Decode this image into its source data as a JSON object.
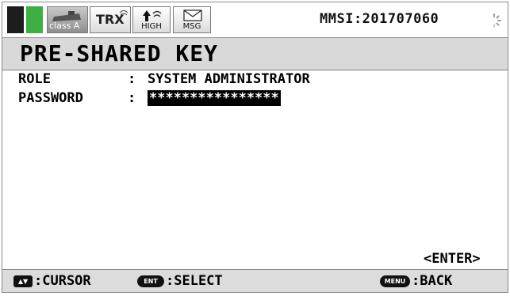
{
  "status_bar": {
    "class_label": "class A",
    "trx_label": "TRX",
    "high_label": "HIGH",
    "msg_label": "MSG",
    "mmsi_text": "MMSI:201707060"
  },
  "title": "PRE-SHARED KEY",
  "fields": {
    "role_label": "ROLE",
    "role_value": "SYSTEM ADMINISTRATOR",
    "password_label": "PASSWORD",
    "password_value": "****************",
    "colon": ":"
  },
  "enter_label": "<ENTER>",
  "help_bar": {
    "cursor_key": "▲▼",
    "cursor_label": ":CURSOR",
    "select_key": "ENT",
    "select_label": ":SELECT",
    "back_key": "MENU",
    "back_label": ":BACK"
  },
  "colors": {
    "signal_green": "#3cb043",
    "title_bar": "#d9d9d9",
    "help_bar": "#dcdcdc"
  }
}
